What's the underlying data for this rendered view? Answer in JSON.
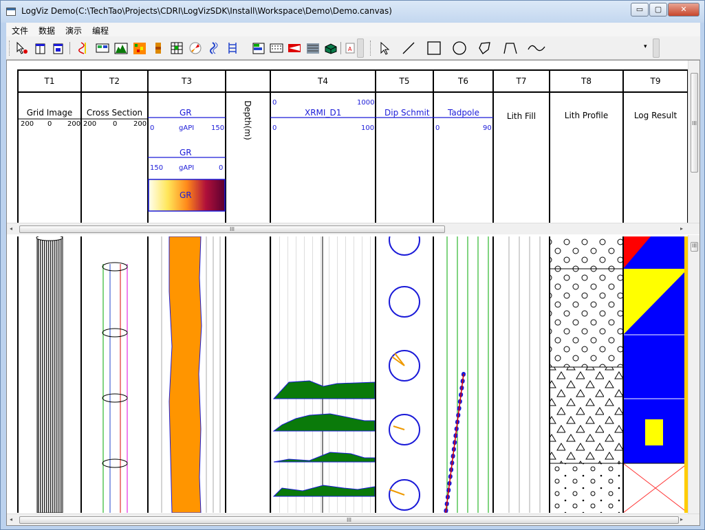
{
  "window": {
    "title": "LogViz Demo(C:\\TechTao\\Projects\\CDRI\\LogVizSDK\\Install\\Workspace\\Demo\\Demo.canvas)",
    "min_label": "▭",
    "max_label": "▢",
    "close_label": "✕"
  },
  "menu": {
    "items": [
      "文件",
      "数据",
      "演示",
      "编程"
    ]
  },
  "tracks": {
    "t1": {
      "name": "T1",
      "curve": "Grid Image",
      "left": "200",
      "mid": "0",
      "right": "200"
    },
    "t2": {
      "name": "T2",
      "curve": "Cross Section",
      "left": "200",
      "mid": "0",
      "right": "200"
    },
    "t3": {
      "name": "T3",
      "curve1": "GR",
      "c1_left": "0",
      "c1_unit": "gAPI",
      "c1_right": "150",
      "curve2": "GR",
      "c2_left": "150",
      "c2_unit": "gAPI",
      "c2_right": "0",
      "fill_label": "GR"
    },
    "depth": {
      "label": "Depth(m)"
    },
    "t4": {
      "name": "T4",
      "curve": "XRMI_D1",
      "top_left": "0",
      "top_right": "1000",
      "left": "0",
      "right": "100"
    },
    "t5": {
      "name": "T5",
      "curve": "Dip Schmit"
    },
    "t6": {
      "name": "T6",
      "curve": "Tadpole",
      "left": "0",
      "right": "90"
    },
    "t7": {
      "name": "T7",
      "curve": "Lith Fill"
    },
    "t8": {
      "name": "T8",
      "curve": "Lith Profile"
    },
    "t9": {
      "name": "T9",
      "curve": "Log Result"
    }
  },
  "scroll": {
    "grip": "III"
  },
  "icons": {
    "toolbar": [
      "select-icon",
      "track-icon",
      "panel-icon",
      "curve-icon",
      "image-icon",
      "histogram-icon",
      "heatmap-icon",
      "core-icon",
      "grid-icon",
      "rose-icon",
      "dip-icon",
      "ladder-icon",
      "bar-icon",
      "pattern-icon",
      "flag-icon",
      "texture-icon",
      "cube-icon",
      "text-icon",
      "pointer-icon",
      "line-icon",
      "rectangle-icon",
      "circle-icon",
      "polygon-icon",
      "polyline-icon",
      "wave-icon"
    ]
  },
  "colors": {
    "blue_track": "#1a1ad8",
    "orange_fill": "#ff9500",
    "green_fill": "#0a7a0a",
    "result_blue": "#0000ff",
    "result_yellow": "#ffff00",
    "result_red": "#ff0000"
  }
}
